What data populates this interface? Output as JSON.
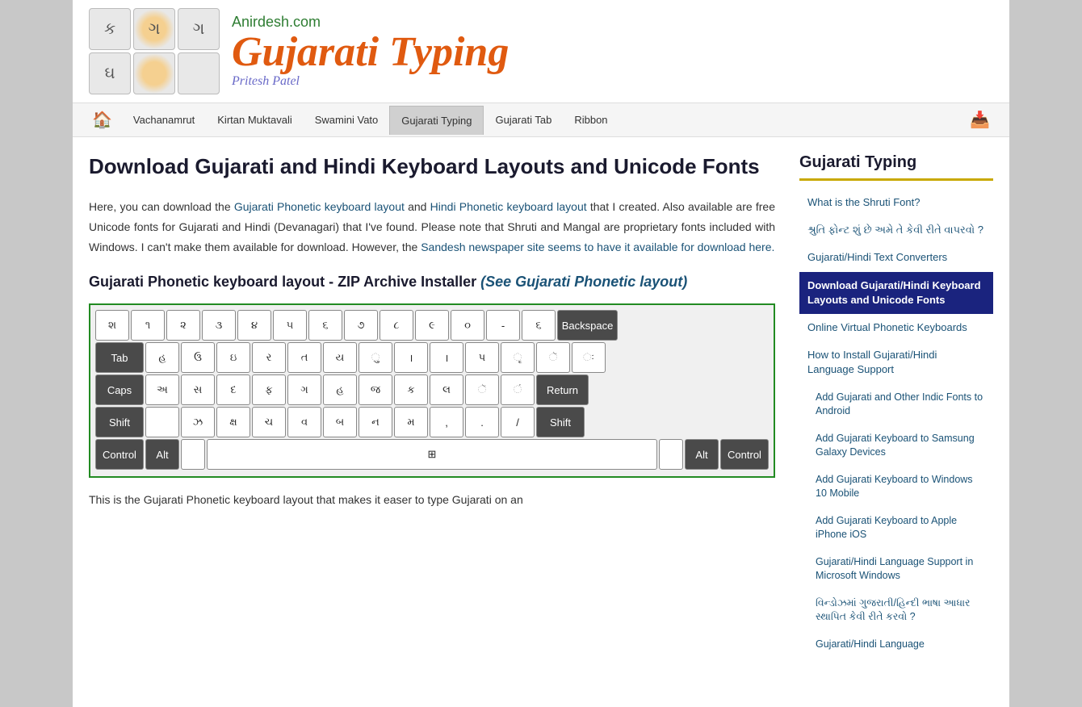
{
  "site": {
    "anirdesh": "Anirdesh.com",
    "title": "Gujarati Typing",
    "subtitle": "Pritesh Patel"
  },
  "nav": {
    "home_icon": "🏠",
    "download_icon": "📥",
    "items": [
      {
        "label": "Vachanamrut",
        "active": false
      },
      {
        "label": "Kirtan Muktavali",
        "active": false
      },
      {
        "label": "Swamini Vato",
        "active": false
      },
      {
        "label": "Gujarati Typing",
        "active": true
      },
      {
        "label": "Gujarati Tab",
        "active": false
      },
      {
        "label": "Ribbon",
        "active": false
      }
    ]
  },
  "main": {
    "title": "Download Gujarati and Hindi Keyboard Layouts and Unicode Fonts",
    "intro": "Here, you can download the Gujarati Phonetic keyboard layout and Hindi Phonetic keyboard layout that I created. Also available are free Unicode fonts for Gujarati and Hindi (Devanagari) that I've found. Please note that Shruti and Mangal are proprietary fonts included with Windows. I can't make them available for download. However, the Sandesh newspaper site seems to have it available for download here.",
    "section1_title": "Gujarati Phonetic keyboard layout - ZIP Archive Installer",
    "section1_italic": "(See Gujarati Phonetic layout)",
    "bottom_text": "This is the Gujarati Phonetic keyboard layout that makes it easer to type Gujarati on an"
  },
  "sidebar": {
    "title": "Gujarati Typing",
    "links": [
      {
        "label": "What is the Shruti Font?",
        "active": false,
        "sub": false
      },
      {
        "label": "શ્રુતિ ફોન્ટ શું છે અમે તે કેવી રીતે વાપરવો ?",
        "active": false,
        "sub": false
      },
      {
        "label": "Gujarati/Hindi Text Converters",
        "active": false,
        "sub": false
      },
      {
        "label": "Download Gujarati/Hindi Keyboard Layouts and Unicode Fonts",
        "active": true,
        "sub": false
      },
      {
        "label": "Online Virtual Phonetic Keyboards",
        "active": false,
        "sub": false
      },
      {
        "label": "How to Install Gujarati/Hindi Language Support",
        "active": false,
        "sub": false
      },
      {
        "label": "Add Gujarati and Other Indic Fonts to Android",
        "active": false,
        "sub": true
      },
      {
        "label": "Add Gujarati Keyboard to Samsung Galaxy Devices",
        "active": false,
        "sub": true
      },
      {
        "label": "Add Gujarati Keyboard to Windows 10 Mobile",
        "active": false,
        "sub": true
      },
      {
        "label": "Add Gujarati Keyboard to Apple iPhone iOS",
        "active": false,
        "sub": true
      },
      {
        "label": "Gujarati/Hindi Language Support in Microsoft Windows",
        "active": false,
        "sub": true
      },
      {
        "label": "વિન્ડોઝમાં ગુજરાતી/હિન્દી ભાષા આધાર સ્થાપિત કેવી રીતે કરવો ?",
        "active": false,
        "sub": true
      },
      {
        "label": "Gujarati/Hindi Language",
        "active": false,
        "sub": true
      }
    ]
  },
  "keyboard": {
    "rows": [
      [
        "શ",
        "૧",
        "૨",
        "૩",
        "૪",
        "૫",
        "૬",
        "૭",
        "૮",
        "૯",
        "૦",
        "-",
        "૬",
        "Backspace"
      ],
      [
        "Tab",
        "હ",
        "ઉ",
        "ઇ",
        "૨",
        "ત",
        "ય",
        "ુ",
        "।",
        "।",
        "પ",
        "ૃ",
        "ૅ",
        "ઃ"
      ],
      [
        "Caps",
        "અ",
        "સ",
        "દ",
        "ફ",
        "ગ",
        "હ",
        "જ",
        "ક",
        "લ",
        "ૅ",
        "ં",
        "Return"
      ],
      [
        "Shift",
        "",
        "ઝ",
        "ક્ષ",
        "ચ",
        "વ",
        "બ",
        "ન",
        "મ",
        ",",
        ".",
        "/",
        "Shift"
      ],
      [
        "Control",
        "Alt",
        "",
        "",
        "",
        "",
        "",
        "",
        "",
        "",
        "Alt",
        "Control"
      ]
    ]
  }
}
